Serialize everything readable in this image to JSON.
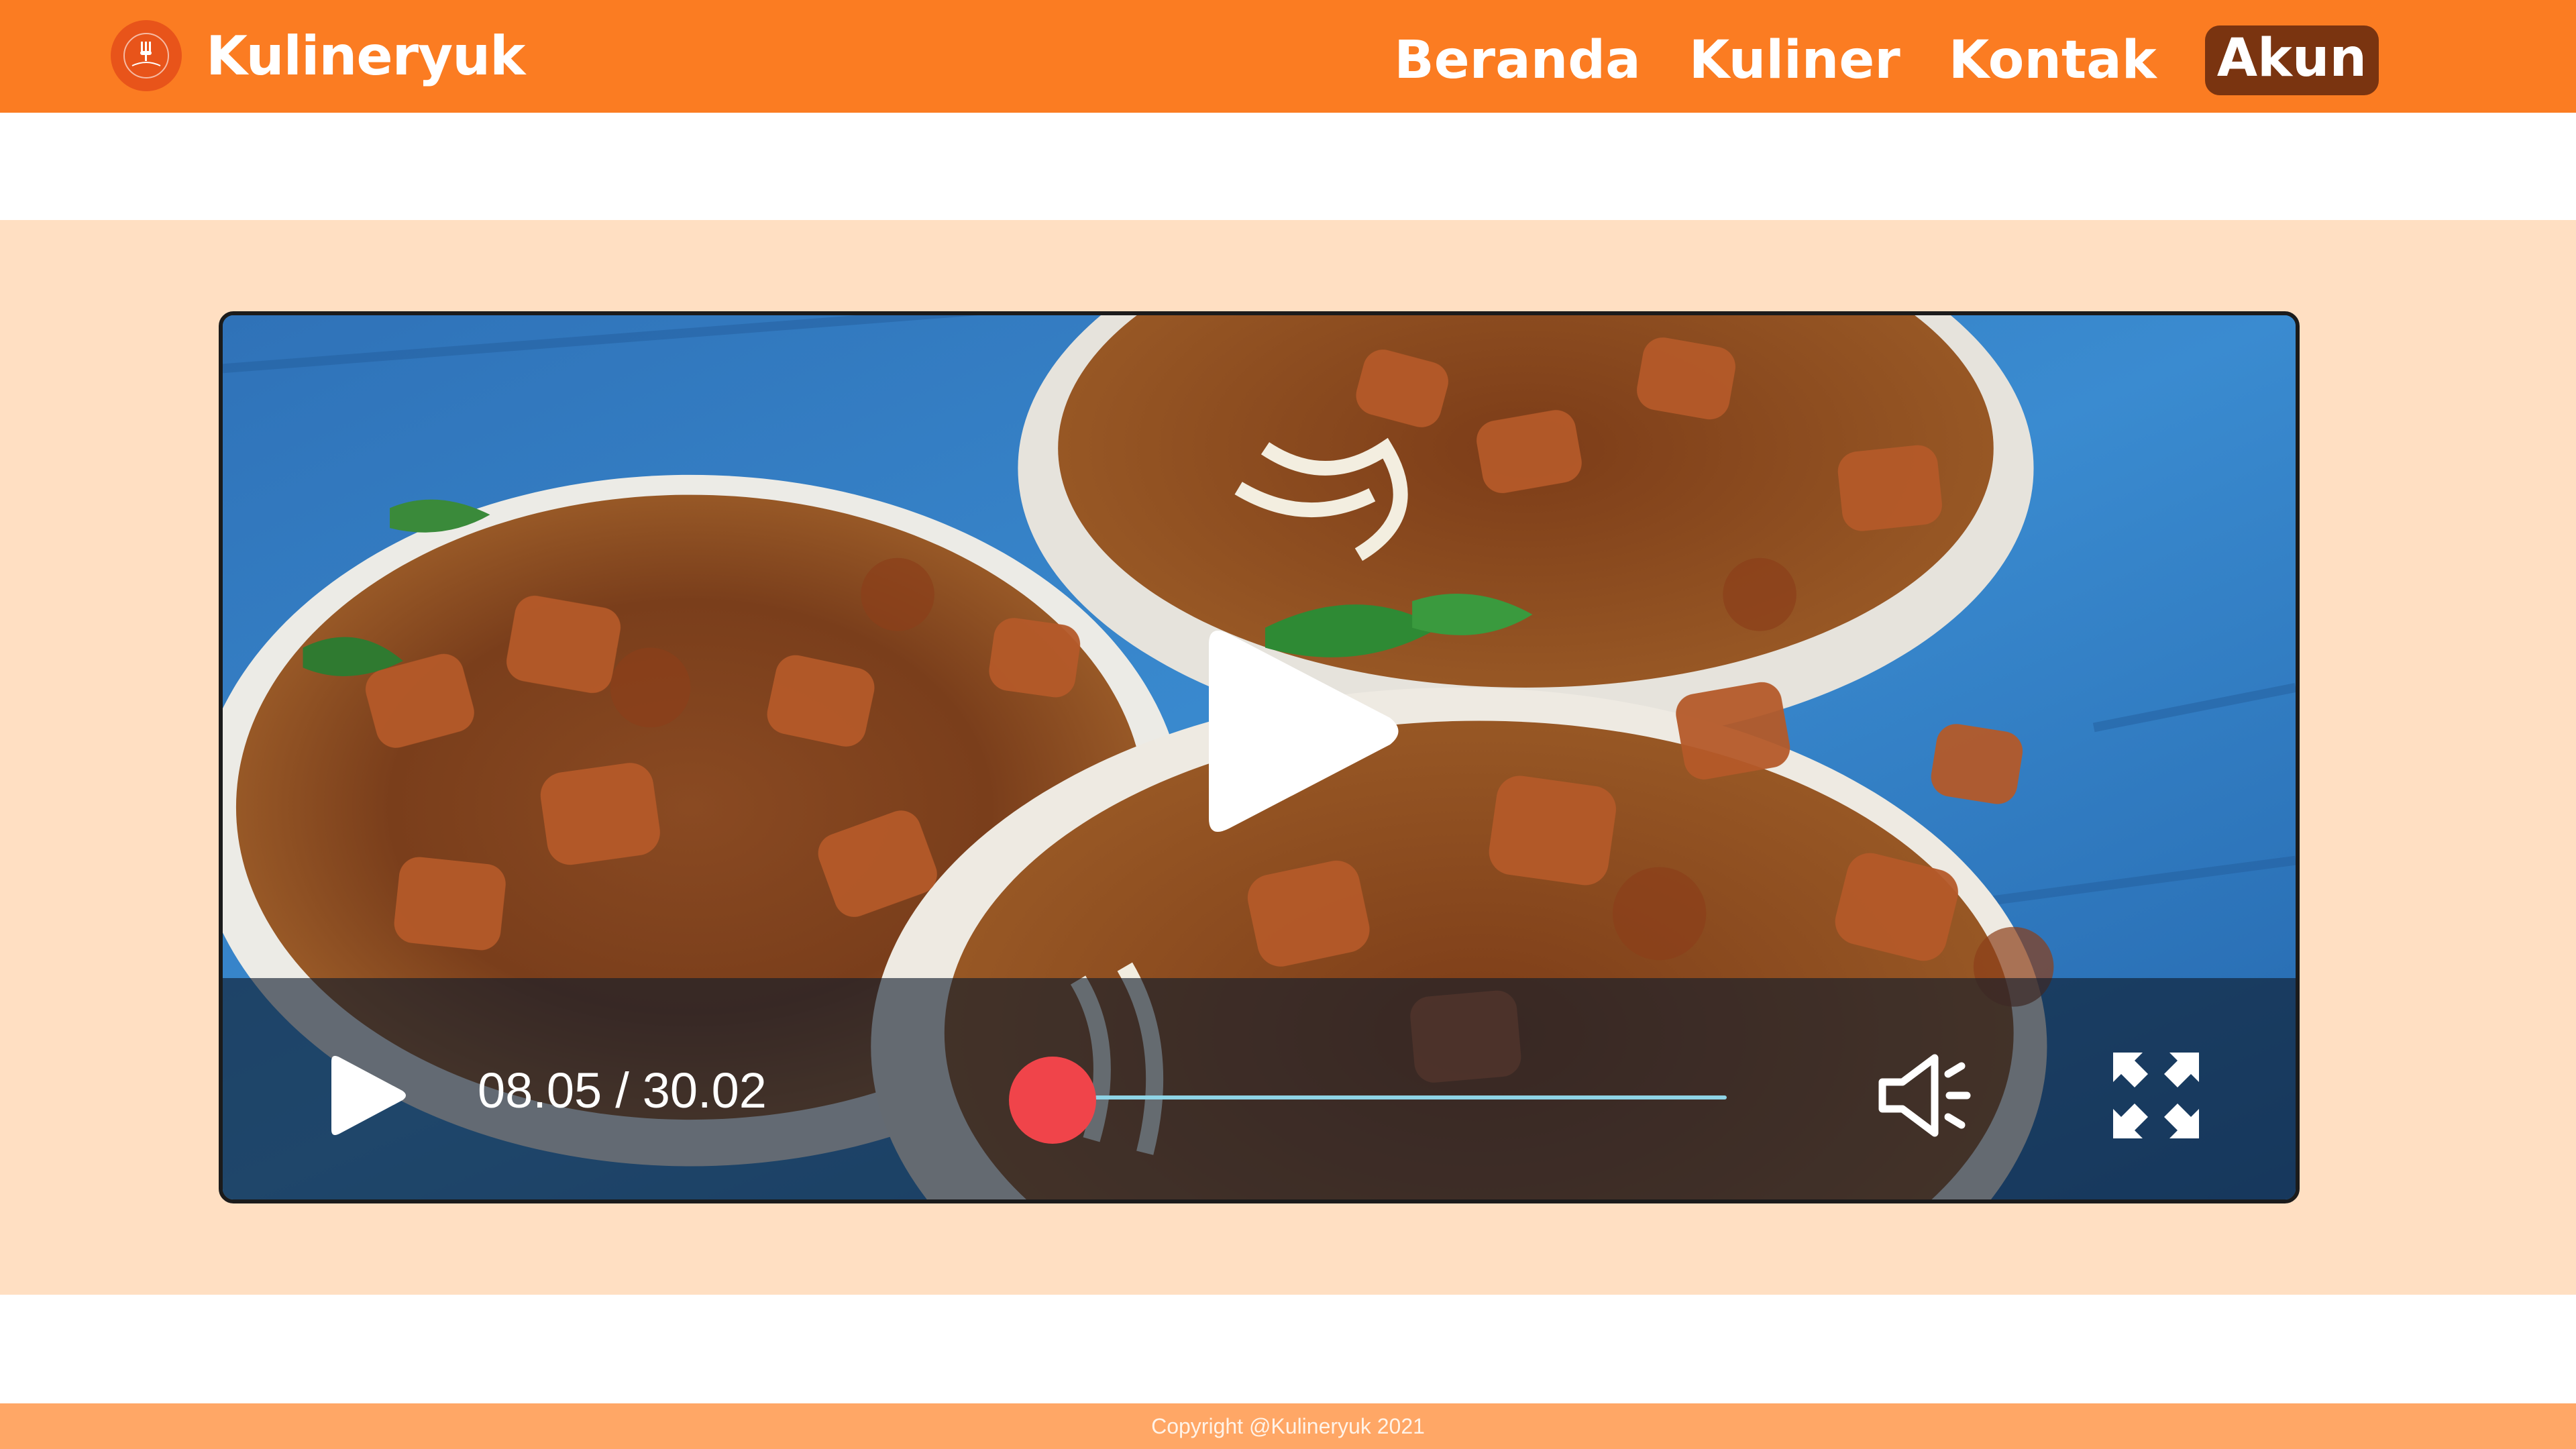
{
  "header": {
    "brand": "Kulineryuk",
    "logo_icon": "utensils-logo-icon",
    "nav": [
      {
        "label": "Beranda",
        "active": false
      },
      {
        "label": "Kuliner",
        "active": false
      },
      {
        "label": "Kontak",
        "active": false
      },
      {
        "label": "Akun",
        "active": true
      }
    ]
  },
  "video": {
    "current_time": "08.05",
    "separator": "/",
    "duration": "30.02",
    "progress_fraction": 0.0,
    "big_play_icon": "play-icon",
    "control_icons": {
      "play": "play-icon",
      "volume": "speaker-icon",
      "fullscreen": "fullscreen-icon"
    }
  },
  "footer": {
    "copyright": "Copyright @Kulineryuk 2021"
  },
  "colors": {
    "header_bg": "#fb7c22",
    "active_nav_bg": "#7a3410",
    "band_bg": "#ffdfc2",
    "footer_bg": "#ffa766",
    "progress_knob": "#f0444a",
    "progress_track": "#8fd4e6"
  }
}
